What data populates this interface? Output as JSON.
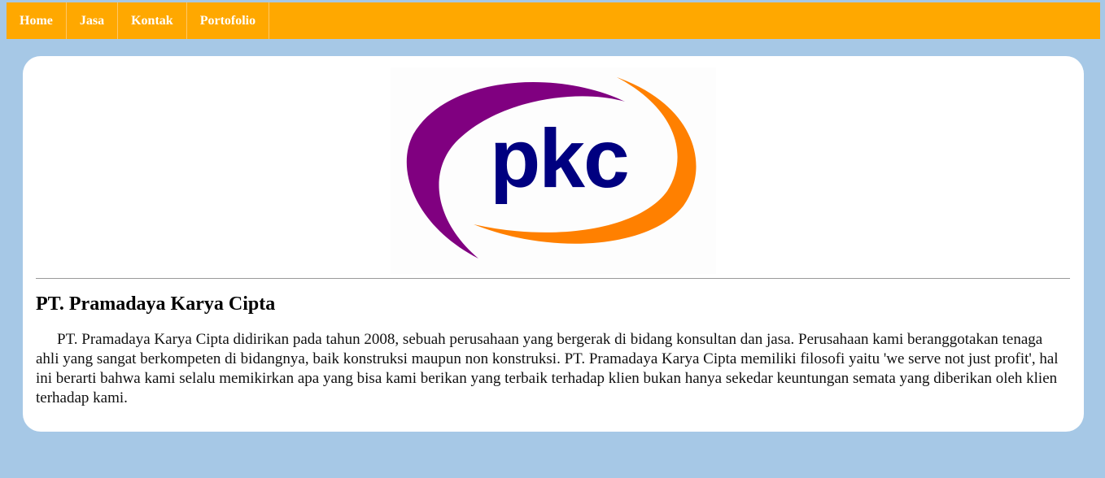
{
  "nav": {
    "items": [
      {
        "label": "Home"
      },
      {
        "label": "Jasa"
      },
      {
        "label": "Kontak"
      },
      {
        "label": "Portofolio"
      }
    ],
    "background_color": "#ffa800",
    "text_color": "#ffffff"
  },
  "page": {
    "background_color": "#a6c8e6"
  },
  "logo": {
    "text": "pkc",
    "text_color": "#000080",
    "purple_swoosh_color": "#800080",
    "orange_swoosh_color": "#ff8000"
  },
  "company": {
    "title": "PT. Pramadaya Karya Cipta",
    "description": "PT. Pramadaya Karya Cipta didirikan pada tahun 2008, sebuah perusahaan yang bergerak di bidang konsultan dan jasa. Perusahaan kami beranggotakan tenaga ahli yang sangat berkompeten di bidangnya, baik konstruksi maupun non konstruksi. PT. Pramadaya Karya Cipta memiliki filosofi yaitu 'we serve not just profit', hal ini berarti bahwa kami selalu memikirkan apa yang bisa kami berikan yang terbaik terhadap klien bukan hanya sekedar keuntungan semata yang diberikan oleh klien terhadap kami."
  }
}
